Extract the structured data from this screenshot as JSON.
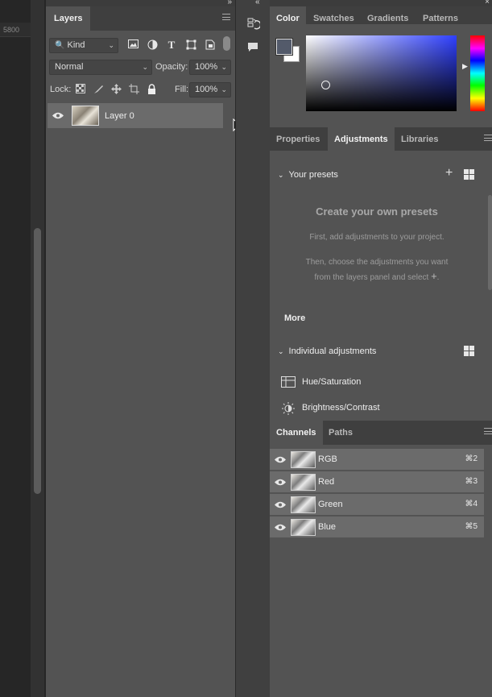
{
  "canvas": {
    "ruler_value": "5800"
  },
  "layers_panel": {
    "tab_label": "Layers",
    "filter_kind": "Kind",
    "blend_mode": "Normal",
    "opacity_label": "Opacity:",
    "opacity_value": "100%",
    "lock_label": "Lock:",
    "fill_label": "Fill:",
    "fill_value": "100%",
    "layers": [
      {
        "name": "Layer 0",
        "visible": true
      }
    ]
  },
  "color_panel": {
    "tabs": [
      "Color",
      "Swatches",
      "Gradients",
      "Patterns"
    ],
    "active_tab": "Color",
    "foreground_color": "#535a6a",
    "background_color": "#ffffff"
  },
  "adjustments_panel": {
    "tabs": [
      "Properties",
      "Adjustments",
      "Libraries"
    ],
    "active_tab": "Adjustments",
    "your_presets_label": "Your presets",
    "create_title": "Create your own presets",
    "create_line1": "First, add adjustments to your project.",
    "create_line2": "Then, choose the adjustments you want",
    "create_line3": "from the layers panel and select",
    "create_line3_suffix": ".",
    "more_label": "More",
    "individual_label": "Individual adjustments",
    "items": [
      "Hue/Saturation",
      "Brightness/Contrast"
    ]
  },
  "channels_panel": {
    "tabs": [
      "Channels",
      "Paths"
    ],
    "active_tab": "Channels",
    "channels": [
      {
        "name": "RGB",
        "shortcut": "⌘2"
      },
      {
        "name": "Red",
        "shortcut": "⌘3"
      },
      {
        "name": "Green",
        "shortcut": "⌘4"
      },
      {
        "name": "Blue",
        "shortcut": "⌘5"
      }
    ]
  }
}
